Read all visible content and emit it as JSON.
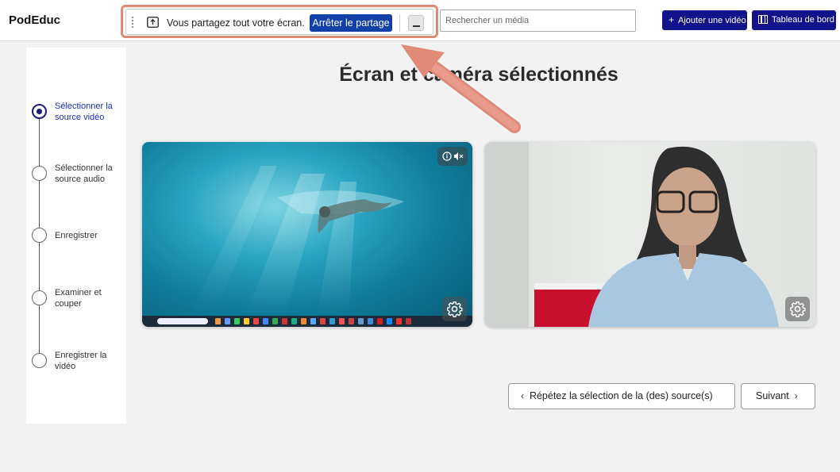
{
  "app": {
    "title": "PodEduc"
  },
  "share_bar": {
    "message": "Vous partagez tout votre écran.",
    "stop_label": "Arrêter le partage",
    "minimize_label": "_"
  },
  "header": {
    "search_placeholder": "Rechercher un média",
    "add_video_label": "Ajouter une vidéo",
    "dashboard_label": "Tableau de bord"
  },
  "steps": [
    {
      "label": "Sélectionner la source vidéo",
      "state": "active"
    },
    {
      "label": "Sélectionner la source audio",
      "state": "pending"
    },
    {
      "label": "Enregistrer",
      "state": "pending"
    },
    {
      "label": "Examiner et couper",
      "state": "pending"
    },
    {
      "label": "Enregistrer la vidéo",
      "state": "pending"
    }
  ],
  "main": {
    "heading": "Écran et caméra sélectionnés",
    "repeat_label": "Répétez la sélection de la (des) source(s)",
    "next_label": "Suivant"
  },
  "icons": {
    "share": "share-screen-icon",
    "add": "plus-icon",
    "dashboard": "film-icon",
    "settings": "gear-icon",
    "info": "info-icon",
    "mute": "muted-speaker-icon",
    "prev": "chevron-left-icon",
    "next": "chevron-right-icon"
  },
  "colors": {
    "primary": "#12128a",
    "stop_button": "#1140a8",
    "active_step": "#1a2fb8",
    "annotation": "#e08a78"
  }
}
